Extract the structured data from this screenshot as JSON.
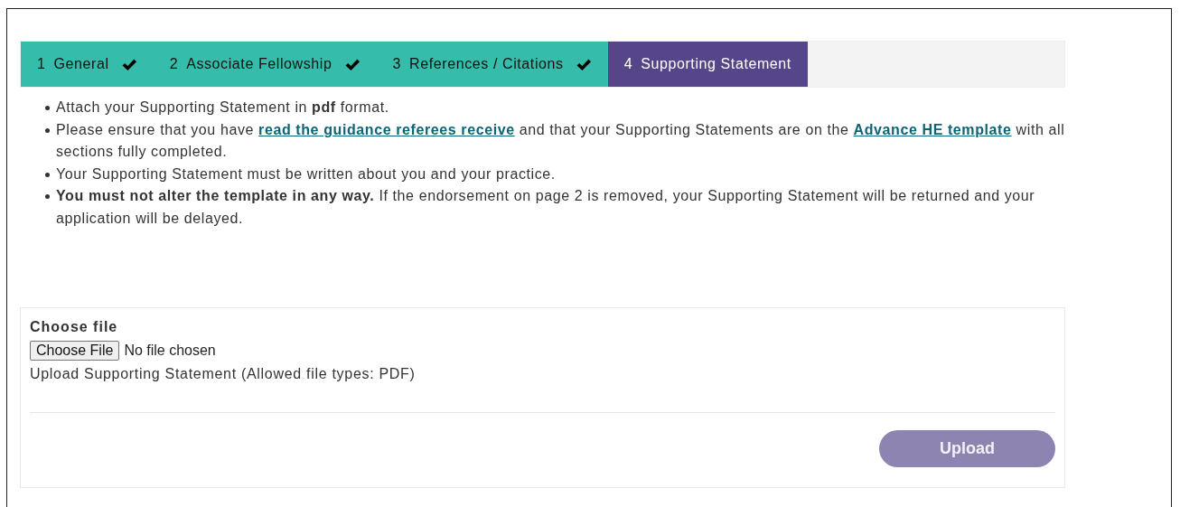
{
  "steps": [
    {
      "number": "1",
      "label": "General",
      "completed": true,
      "selected": false
    },
    {
      "number": "2",
      "label": "Associate Fellowship",
      "completed": true,
      "selected": false
    },
    {
      "number": "3",
      "label": "References / Citations",
      "completed": true,
      "selected": false
    },
    {
      "number": "4",
      "label": "Supporting Statement",
      "completed": false,
      "selected": true
    }
  ],
  "instructions": [
    {
      "parts": [
        {
          "kind": "text",
          "text": "Attach your Supporting Statement in **pdf** format."
        }
      ]
    },
    {
      "parts": [
        {
          "kind": "text",
          "text": "Please ensure that you have "
        },
        {
          "kind": "link",
          "text": "read the guidance referees receive"
        },
        {
          "kind": "text",
          "text": " and that your Supporting Statements are on the "
        },
        {
          "kind": "link",
          "text": "Advance HE template"
        },
        {
          "kind": "text",
          "text": " with all sections fully completed."
        }
      ]
    },
    {
      "parts": [
        {
          "kind": "text",
          "text": "Your Supporting Statement must be written about you and your practice."
        }
      ]
    },
    {
      "parts": [
        {
          "kind": "text",
          "text": "**You must not alter the template in any way.** If the endorsement on page 2 is removed, your Supporting Statement will be returned and your application will be delayed."
        }
      ]
    }
  ],
  "upload": {
    "label": "Choose file",
    "file_button": "Choose File",
    "file_status": "No file chosen",
    "hint": "Upload Supporting Statement (Allowed file types: PDF)",
    "button": {
      "label": "Upload",
      "disabled": true
    }
  }
}
